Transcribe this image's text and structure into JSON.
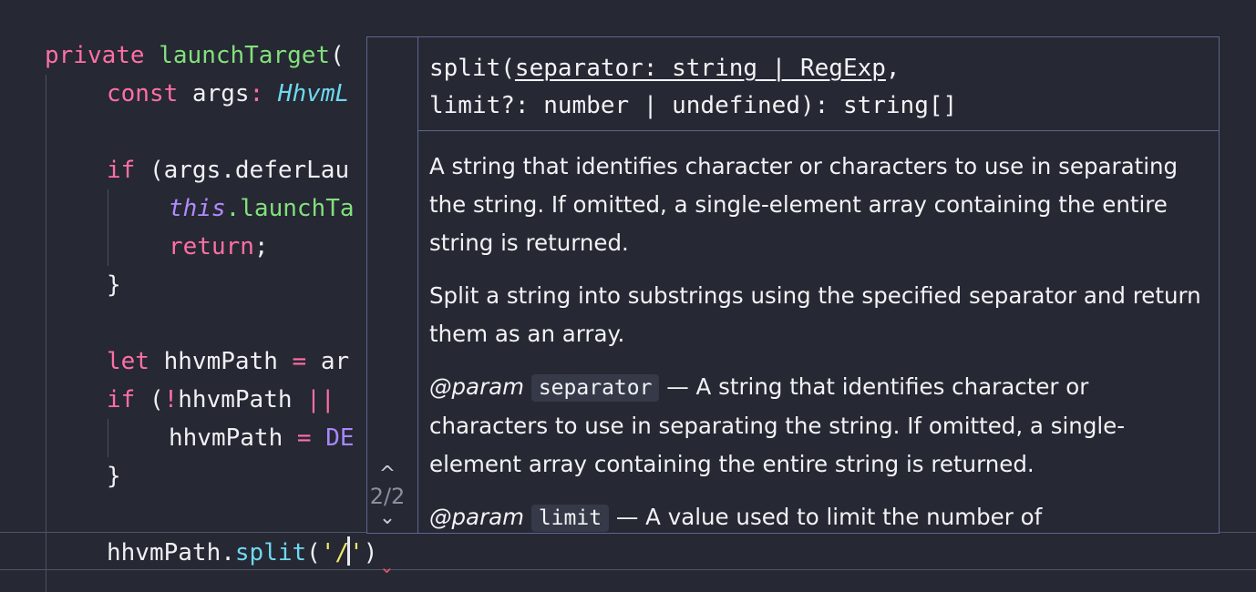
{
  "editor": {
    "lines": {
      "l1": {
        "kw": "private",
        "space": " ",
        "fn": "launchTarget",
        "paren": "("
      },
      "l2": {
        "kw": "const",
        "name": " args",
        "colon": ": ",
        "type": "HhvmL"
      },
      "l4": {
        "kw": "if",
        "rest": " (args.deferLau"
      },
      "l5": {
        "this": "this",
        "rest": ".launchTa"
      },
      "l6": {
        "kw": "return",
        "semi": ";"
      },
      "l7": {
        "brace": "}"
      },
      "l9": {
        "kw": "let",
        "name": " hhvmPath ",
        "eq": "=",
        "rest": " ar"
      },
      "l10": {
        "kw": "if",
        "paren": " (",
        "bang": "!",
        "name": "hhvmPath ",
        "op": "||"
      },
      "l11": {
        "name": "hhvmPath ",
        "eq": "=",
        "space": " ",
        "const": "DE"
      },
      "l12": {
        "brace": "}"
      },
      "l14": {
        "obj": "hhvmPath",
        "dot": ".",
        "method": "split",
        "open": "(",
        "q1": "'/",
        "q2": "'",
        "close": ")"
      }
    },
    "error_marker": "⌄"
  },
  "signature_help": {
    "nav": {
      "up_icon": "^",
      "counter": "2/2",
      "down_icon": "⌄"
    },
    "signature": {
      "name": "split(",
      "active_param": "separator: string | RegExp",
      "after_active": ",",
      "line2": "limit?: number | undefined): string[]"
    },
    "doc": {
      "param_description": "A string that identifies character or characters to use in separating the string. If omitted, a single-element array containing the entire string is returned.",
      "summary": "Split a string into substrings using the specified separator and return them as an array.",
      "param1_tag": "@param",
      "param1_name": "separator",
      "param1_text": " — A string that identifies character or characters to use in separating the string. If omitted, a single-element array containing the entire string is returned.",
      "param2_tag": "@param",
      "param2_name": "limit",
      "param2_text": " — A value used to limit the number of"
    }
  },
  "colors": {
    "background": "#262833",
    "keyword": "#ff6fa5",
    "function": "#82e07c",
    "type": "#6fd8f0",
    "string": "#f3e86b",
    "popup_border": "#5d6690"
  }
}
